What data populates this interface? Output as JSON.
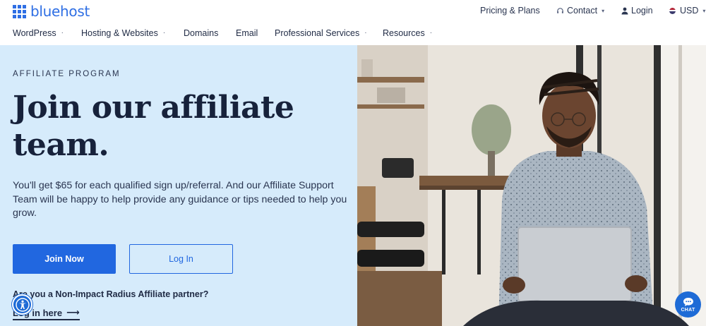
{
  "brand": {
    "name": "bluehost",
    "color": "#2f6fe4"
  },
  "utility_nav": {
    "pricing": "Pricing & Plans",
    "contact": "Contact",
    "login": "Login",
    "currency": "USD"
  },
  "main_nav": [
    {
      "label": "WordPress",
      "has_dropdown": true
    },
    {
      "label": "Hosting & Websites",
      "has_dropdown": true
    },
    {
      "label": "Domains",
      "has_dropdown": false
    },
    {
      "label": "Email",
      "has_dropdown": false
    },
    {
      "label": "Professional Services",
      "has_dropdown": true
    },
    {
      "label": "Resources",
      "has_dropdown": true
    }
  ],
  "hero": {
    "eyebrow": "AFFILIATE PROGRAM",
    "headline_line1": "Join our affiliate",
    "headline_line2": "team.",
    "description": "You'll get $65 for each qualified sign up/referral. And our Affiliate Support Team will be happy to help provide any guidance or tips needed to help you grow.",
    "join_button": "Join Now",
    "login_button": "Log In",
    "partner_question": "Are you a Non-Impact Radius Affiliate partner?",
    "partner_link": "Log in here",
    "partner_link_arrow": "⟶"
  },
  "chat": {
    "label": "CHAT"
  },
  "colors": {
    "hero_bg": "#d6ebfb",
    "primary": "#2167e0",
    "heading": "#17223b"
  },
  "icons": [
    "logo-grid-icon",
    "headset-icon",
    "user-icon",
    "us-flag-icon",
    "accessibility-icon",
    "chat-bubble-icon",
    "arrow-right-icon"
  ]
}
